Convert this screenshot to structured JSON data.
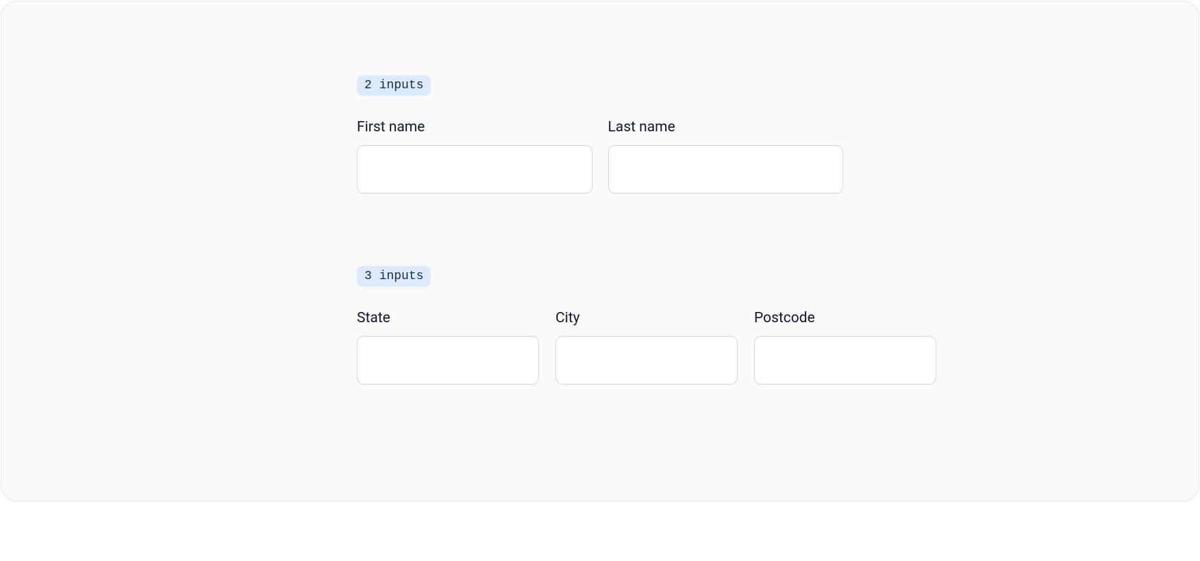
{
  "sections": [
    {
      "badge": "2 inputs",
      "fields": [
        {
          "label": "First name",
          "value": ""
        },
        {
          "label": "Last name",
          "value": ""
        }
      ]
    },
    {
      "badge": "3 inputs",
      "fields": [
        {
          "label": "State",
          "value": ""
        },
        {
          "label": "City",
          "value": ""
        },
        {
          "label": "Postcode",
          "value": ""
        }
      ]
    }
  ]
}
